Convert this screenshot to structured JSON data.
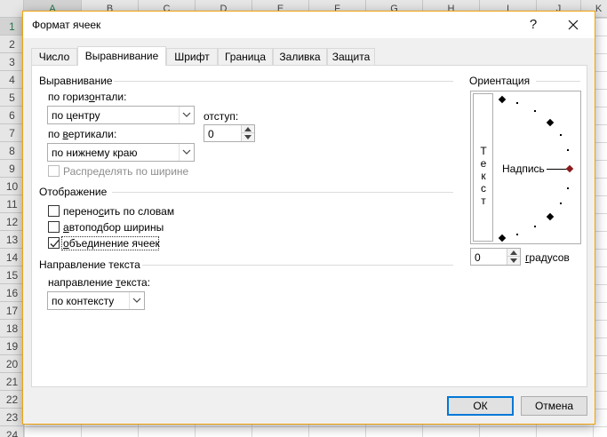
{
  "spreadsheet": {
    "columns": [
      "A",
      "B",
      "C",
      "D",
      "E",
      "F",
      "G",
      "H",
      "I",
      "J",
      "K"
    ],
    "rows": [
      "1",
      "2",
      "3",
      "4",
      "5",
      "6",
      "7",
      "8",
      "9",
      "10",
      "11",
      "12",
      "13",
      "14",
      "15",
      "16",
      "17",
      "18",
      "19",
      "20",
      "21",
      "22",
      "23",
      "24"
    ],
    "active_row": "1",
    "active_column": "A"
  },
  "dialog": {
    "title": "Формат ячеек",
    "help_label": "?",
    "tabs": [
      {
        "label": "Число",
        "active": false
      },
      {
        "label": "Выравнивание",
        "active": true
      },
      {
        "label": "Шрифт",
        "active": false
      },
      {
        "label": "Граница",
        "active": false
      },
      {
        "label": "Заливка",
        "active": false
      },
      {
        "label": "Защита",
        "active": false
      }
    ],
    "alignment": {
      "section_title": "Выравнивание",
      "horizontal_label_pre": "по гориз",
      "horizontal_label_key": "о",
      "horizontal_label_post": "нтали:",
      "horizontal_value": "по центру",
      "indent_label": "отступ:",
      "indent_value": "0",
      "vertical_label_pre": "по ",
      "vertical_label_key": "в",
      "vertical_label_post": "ертикали:",
      "vertical_value": "по нижнему краю",
      "distribute_label": "Распределять по ширине"
    },
    "display": {
      "section_title": "Отображение",
      "wrap_label_pre": "перено",
      "wrap_label_key": "с",
      "wrap_label_post": "ить по словам",
      "wrap_checked": false,
      "autofit_label_key": "а",
      "autofit_label_post": "втоподбор ширины",
      "autofit_checked": false,
      "merge_label_key": "о",
      "merge_label_post": "бъединение ячеек",
      "merge_checked": true
    },
    "direction": {
      "section_title": "Направление текста",
      "label_pre": "направление ",
      "label_key": "т",
      "label_post": "екста:",
      "value": "по контексту"
    },
    "orientation": {
      "section_title": "Ориентация",
      "vertical_text": [
        "Т",
        "е",
        "к",
        "с",
        "т"
      ],
      "caption": "Надпись",
      "degrees_value": "0",
      "degrees_label_key": "г",
      "degrees_label_post": "радусов"
    },
    "buttons": {
      "ok": "ОК",
      "cancel": "Отмена"
    }
  }
}
